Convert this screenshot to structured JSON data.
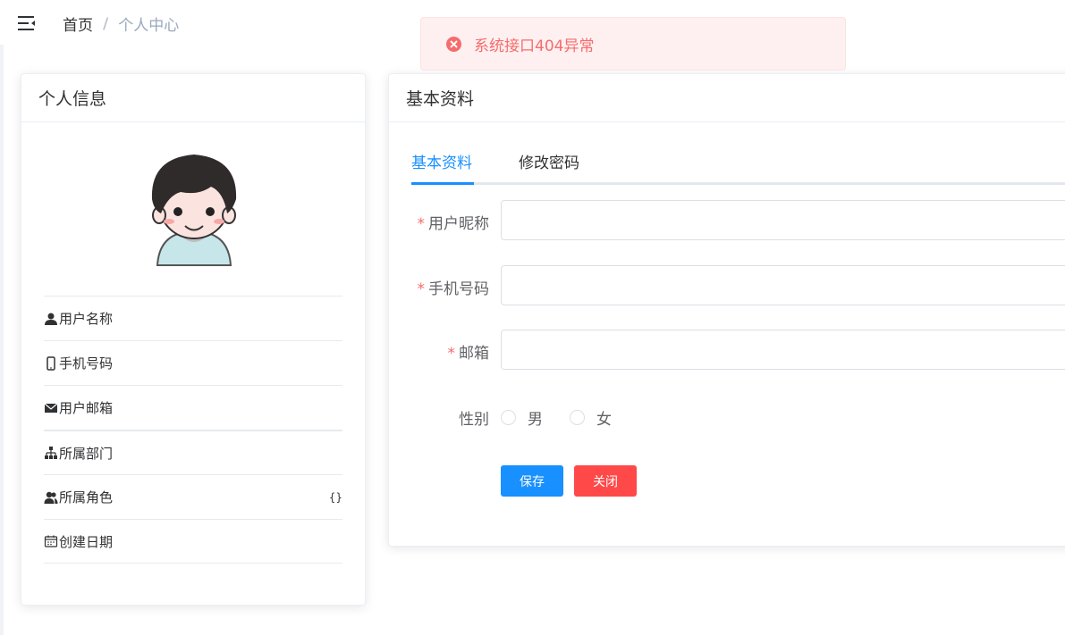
{
  "navbar": {
    "menu_icon": "hamburger-icon",
    "breadcrumb": {
      "home": "首页",
      "separator": "/",
      "current": "个人中心"
    }
  },
  "message": {
    "icon": "circle-close-icon",
    "text": "系统接口404异常",
    "color": "#f56c6c"
  },
  "profile_card": {
    "title": "个人信息",
    "avatar_icon": "user-avatar",
    "items": [
      {
        "icon": "user-icon",
        "label": "用户名称",
        "value": ""
      },
      {
        "icon": "phone-icon",
        "label": "手机号码",
        "value": ""
      },
      {
        "icon": "email-icon",
        "label": "用户邮箱",
        "value": ""
      },
      {
        "icon": "tree-icon",
        "label": "所属部门",
        "value": ""
      },
      {
        "icon": "peoples-icon",
        "label": "所属角色",
        "value": "{}"
      },
      {
        "icon": "date-icon",
        "label": "创建日期",
        "value": ""
      }
    ]
  },
  "basic_card": {
    "title": "基本资料",
    "tabs": [
      {
        "label": "基本资料",
        "active": true
      },
      {
        "label": "修改密码",
        "active": false
      }
    ],
    "form": {
      "nickname": {
        "label": "用户昵称",
        "required": "*",
        "value": ""
      },
      "phone": {
        "label": "手机号码",
        "required": "*",
        "value": ""
      },
      "email": {
        "label": "邮箱",
        "required": "*",
        "value": ""
      },
      "sex": {
        "label": "性别",
        "options": [
          "男",
          "女"
        ]
      }
    },
    "buttons": {
      "save": "保存",
      "close": "关闭"
    }
  },
  "colors": {
    "primary": "#1890ff",
    "danger": "#ff4949",
    "error_bg": "#fef0f0"
  }
}
